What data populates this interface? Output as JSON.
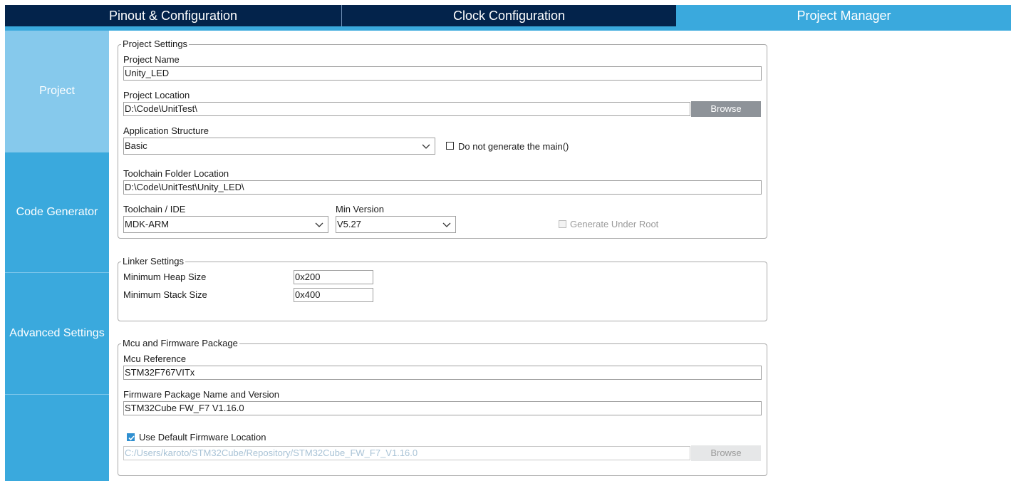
{
  "tabs": [
    {
      "label": "Pinout & Configuration"
    },
    {
      "label": "Clock Configuration"
    },
    {
      "label": "Project Manager"
    }
  ],
  "sidebar": {
    "items": [
      {
        "label": "Project"
      },
      {
        "label": "Code Generator"
      },
      {
        "label": "Advanced Settings"
      },
      {
        "label": ""
      }
    ]
  },
  "project_settings": {
    "title": "Project Settings",
    "project_name_label": "Project Name",
    "project_name_value": "Unity_LED",
    "project_location_label": "Project Location",
    "project_location_value": "D:\\Code\\UnitTest\\",
    "browse_label": "Browse",
    "app_structure_label": "Application Structure",
    "app_structure_value": "Basic",
    "no_main_label": "Do not generate the main()",
    "toolchain_folder_label": "Toolchain Folder Location",
    "toolchain_folder_value": "D:\\Code\\UnitTest\\Unity_LED\\",
    "toolchain_ide_label": "Toolchain / IDE",
    "toolchain_ide_value": "MDK-ARM",
    "min_version_label": "Min Version",
    "min_version_value": "V5.27",
    "generate_under_root_label": "Generate Under Root"
  },
  "linker_settings": {
    "title": "Linker Settings",
    "heap_label": "Minimum Heap Size",
    "heap_value": "0x200",
    "stack_label": "Minimum Stack Size",
    "stack_value": "0x400"
  },
  "mcu_firmware": {
    "title": "Mcu and Firmware Package",
    "mcu_reference_label": "Mcu Reference",
    "mcu_reference_value": "STM32F767VITx",
    "fw_package_label": "Firmware Package Name and Version",
    "fw_package_value": "STM32Cube FW_F7 V1.16.0",
    "use_default_label": "Use Default Firmware Location",
    "fw_location_value": "C:/Users/karoto/STM32Cube/Repository/STM32Cube_FW_F7_V1.16.0",
    "browse_label": "Browse"
  },
  "colors": {
    "tab_dark": "#03234b",
    "accent": "#3aa9dd",
    "sidebar_selected": "#86c9ec",
    "button_gray": "#8e9399"
  },
  "icons": [
    "chevron-down-icon",
    "checkbox-checked-icon"
  ]
}
